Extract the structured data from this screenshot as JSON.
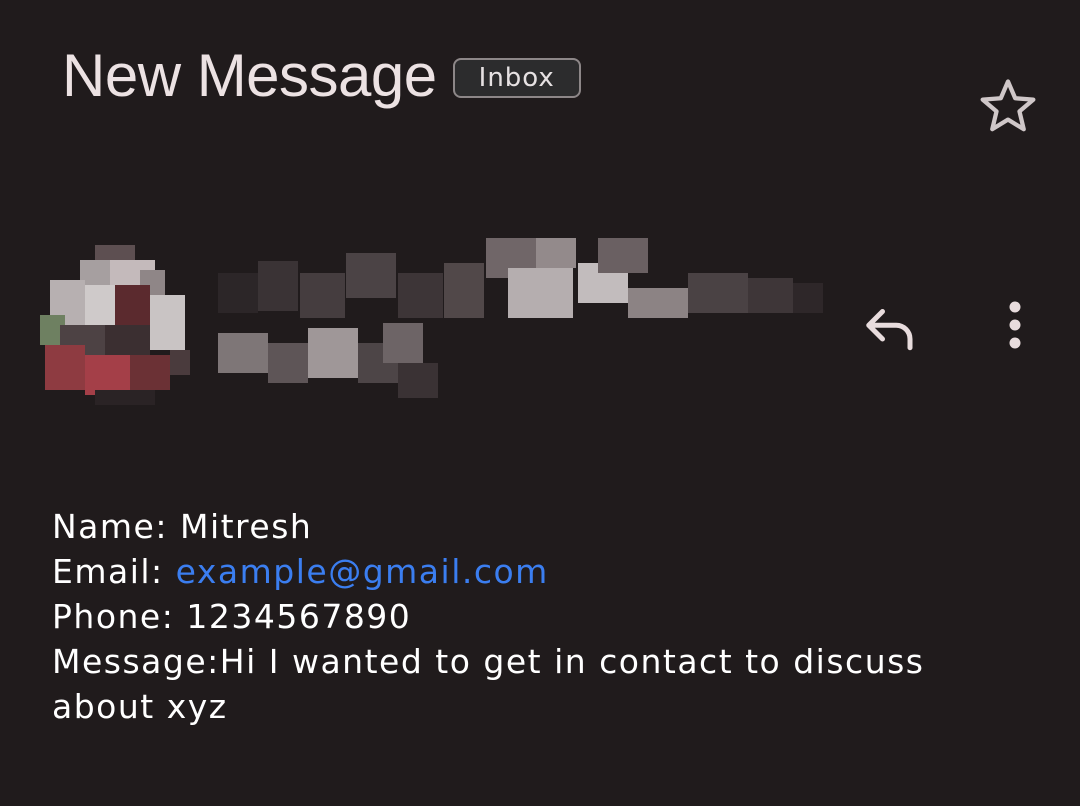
{
  "header": {
    "subject": "New Message",
    "label": "Inbox",
    "star_icon": "star-outline-icon"
  },
  "sender": {
    "avatar": "redacted-avatar",
    "name": "redacted",
    "reply_icon": "reply-icon",
    "more_icon": "more-vertical-icon"
  },
  "body": {
    "name_label": "Name: ",
    "name_value": "Mitresh",
    "email_label": "Email: ",
    "email_value": "example@gmail.com",
    "phone_label": "Phone: ",
    "phone_value": "1234567890",
    "message_label": "Message:",
    "message_value": "Hi I wanted to get in contact to discuss about xyz"
  },
  "colors": {
    "background": "#201b1c",
    "link": "#3b7ef0",
    "icon": "#e8dcdd"
  }
}
